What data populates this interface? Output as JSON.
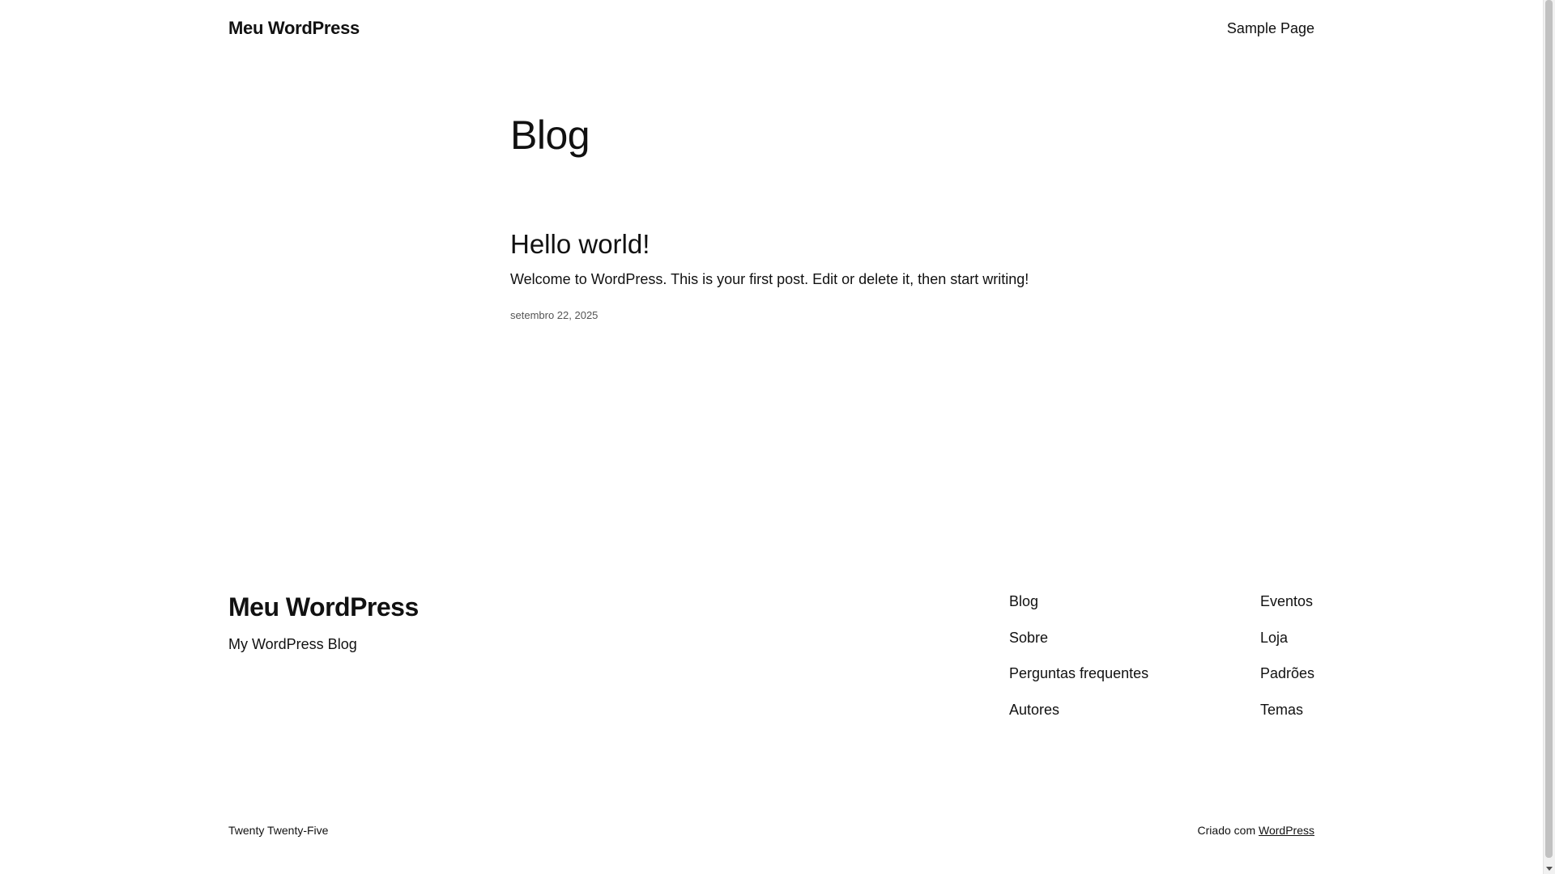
{
  "header": {
    "site_title": "Meu WordPress",
    "nav": [
      "Sample Page"
    ]
  },
  "main": {
    "heading": "Blog",
    "posts": [
      {
        "title": "Hello world!",
        "excerpt": "Welcome to WordPress. This is your first post. Edit or delete it, then start writing!",
        "date": "setembro 22, 2025"
      }
    ]
  },
  "footer": {
    "site_title": "Meu WordPress",
    "tagline": "My WordPress Blog",
    "col1": [
      "Blog",
      "Sobre",
      "Perguntas frequentes",
      "Autores"
    ],
    "col2": [
      "Eventos",
      "Loja",
      "Padrões",
      "Temas"
    ],
    "theme_name": "Twenty Twenty-Five",
    "credit_prefix": "Criado com",
    "credit_link": "WordPress"
  }
}
